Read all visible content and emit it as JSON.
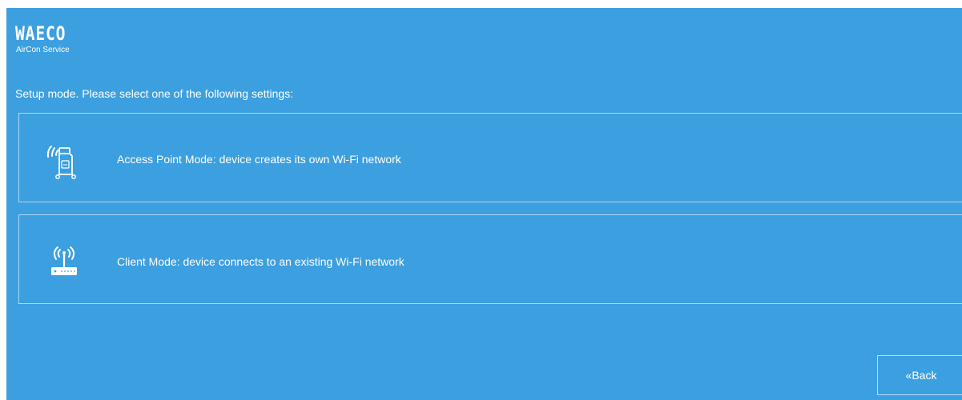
{
  "logo": {
    "brand": "WAECO",
    "subtitle": "AirCon Service"
  },
  "instruction": "Setup mode. Please select one of the following settings:",
  "options": [
    {
      "label": "Access Point Mode: device creates its own Wi-Fi network",
      "icon": "access-point-device-icon"
    },
    {
      "label": "Client Mode: device connects to an existing Wi-Fi network",
      "icon": "router-icon"
    }
  ],
  "back_button": {
    "label": "«Back"
  },
  "colors": {
    "background": "#3c9fdf",
    "text": "#ffffff",
    "border": "#cfe7f8"
  }
}
